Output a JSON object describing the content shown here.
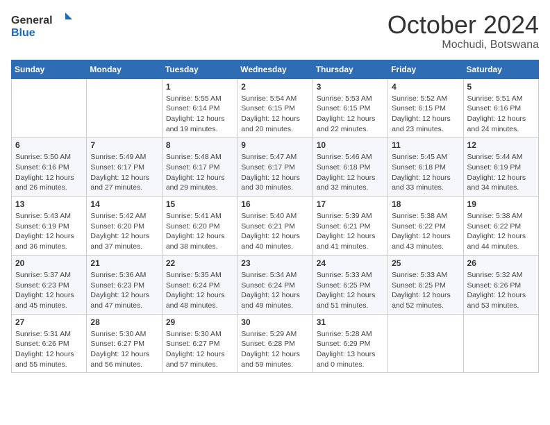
{
  "header": {
    "logo_general": "General",
    "logo_blue": "Blue",
    "month_year": "October 2024",
    "location": "Mochudi, Botswana"
  },
  "weekdays": [
    "Sunday",
    "Monday",
    "Tuesday",
    "Wednesday",
    "Thursday",
    "Friday",
    "Saturday"
  ],
  "weeks": [
    [
      {
        "day": "",
        "info": ""
      },
      {
        "day": "",
        "info": ""
      },
      {
        "day": "1",
        "info": "Sunrise: 5:55 AM\nSunset: 6:14 PM\nDaylight: 12 hours and 19 minutes."
      },
      {
        "day": "2",
        "info": "Sunrise: 5:54 AM\nSunset: 6:15 PM\nDaylight: 12 hours and 20 minutes."
      },
      {
        "day": "3",
        "info": "Sunrise: 5:53 AM\nSunset: 6:15 PM\nDaylight: 12 hours and 22 minutes."
      },
      {
        "day": "4",
        "info": "Sunrise: 5:52 AM\nSunset: 6:15 PM\nDaylight: 12 hours and 23 minutes."
      },
      {
        "day": "5",
        "info": "Sunrise: 5:51 AM\nSunset: 6:16 PM\nDaylight: 12 hours and 24 minutes."
      }
    ],
    [
      {
        "day": "6",
        "info": "Sunrise: 5:50 AM\nSunset: 6:16 PM\nDaylight: 12 hours and 26 minutes."
      },
      {
        "day": "7",
        "info": "Sunrise: 5:49 AM\nSunset: 6:17 PM\nDaylight: 12 hours and 27 minutes."
      },
      {
        "day": "8",
        "info": "Sunrise: 5:48 AM\nSunset: 6:17 PM\nDaylight: 12 hours and 29 minutes."
      },
      {
        "day": "9",
        "info": "Sunrise: 5:47 AM\nSunset: 6:17 PM\nDaylight: 12 hours and 30 minutes."
      },
      {
        "day": "10",
        "info": "Sunrise: 5:46 AM\nSunset: 6:18 PM\nDaylight: 12 hours and 32 minutes."
      },
      {
        "day": "11",
        "info": "Sunrise: 5:45 AM\nSunset: 6:18 PM\nDaylight: 12 hours and 33 minutes."
      },
      {
        "day": "12",
        "info": "Sunrise: 5:44 AM\nSunset: 6:19 PM\nDaylight: 12 hours and 34 minutes."
      }
    ],
    [
      {
        "day": "13",
        "info": "Sunrise: 5:43 AM\nSunset: 6:19 PM\nDaylight: 12 hours and 36 minutes."
      },
      {
        "day": "14",
        "info": "Sunrise: 5:42 AM\nSunset: 6:20 PM\nDaylight: 12 hours and 37 minutes."
      },
      {
        "day": "15",
        "info": "Sunrise: 5:41 AM\nSunset: 6:20 PM\nDaylight: 12 hours and 38 minutes."
      },
      {
        "day": "16",
        "info": "Sunrise: 5:40 AM\nSunset: 6:21 PM\nDaylight: 12 hours and 40 minutes."
      },
      {
        "day": "17",
        "info": "Sunrise: 5:39 AM\nSunset: 6:21 PM\nDaylight: 12 hours and 41 minutes."
      },
      {
        "day": "18",
        "info": "Sunrise: 5:38 AM\nSunset: 6:22 PM\nDaylight: 12 hours and 43 minutes."
      },
      {
        "day": "19",
        "info": "Sunrise: 5:38 AM\nSunset: 6:22 PM\nDaylight: 12 hours and 44 minutes."
      }
    ],
    [
      {
        "day": "20",
        "info": "Sunrise: 5:37 AM\nSunset: 6:23 PM\nDaylight: 12 hours and 45 minutes."
      },
      {
        "day": "21",
        "info": "Sunrise: 5:36 AM\nSunset: 6:23 PM\nDaylight: 12 hours and 47 minutes."
      },
      {
        "day": "22",
        "info": "Sunrise: 5:35 AM\nSunset: 6:24 PM\nDaylight: 12 hours and 48 minutes."
      },
      {
        "day": "23",
        "info": "Sunrise: 5:34 AM\nSunset: 6:24 PM\nDaylight: 12 hours and 49 minutes."
      },
      {
        "day": "24",
        "info": "Sunrise: 5:33 AM\nSunset: 6:25 PM\nDaylight: 12 hours and 51 minutes."
      },
      {
        "day": "25",
        "info": "Sunrise: 5:33 AM\nSunset: 6:25 PM\nDaylight: 12 hours and 52 minutes."
      },
      {
        "day": "26",
        "info": "Sunrise: 5:32 AM\nSunset: 6:26 PM\nDaylight: 12 hours and 53 minutes."
      }
    ],
    [
      {
        "day": "27",
        "info": "Sunrise: 5:31 AM\nSunset: 6:26 PM\nDaylight: 12 hours and 55 minutes."
      },
      {
        "day": "28",
        "info": "Sunrise: 5:30 AM\nSunset: 6:27 PM\nDaylight: 12 hours and 56 minutes."
      },
      {
        "day": "29",
        "info": "Sunrise: 5:30 AM\nSunset: 6:27 PM\nDaylight: 12 hours and 57 minutes."
      },
      {
        "day": "30",
        "info": "Sunrise: 5:29 AM\nSunset: 6:28 PM\nDaylight: 12 hours and 59 minutes."
      },
      {
        "day": "31",
        "info": "Sunrise: 5:28 AM\nSunset: 6:29 PM\nDaylight: 13 hours and 0 minutes."
      },
      {
        "day": "",
        "info": ""
      },
      {
        "day": "",
        "info": ""
      }
    ]
  ]
}
